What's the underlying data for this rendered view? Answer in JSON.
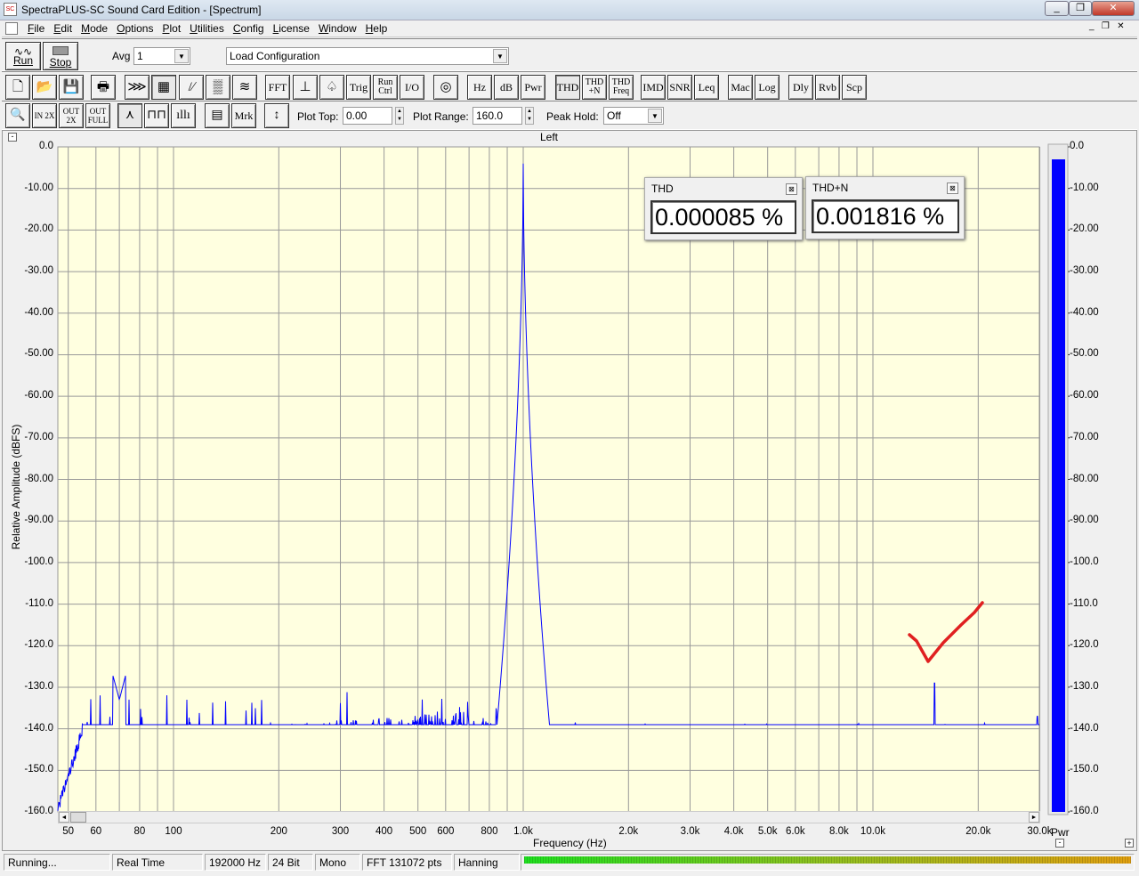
{
  "window": {
    "title": "SpectraPLUS-SC Sound Card Edition - [Spectrum]",
    "app_icon": "spectraplus-icon",
    "controls": [
      "minimize",
      "restore",
      "close"
    ]
  },
  "menu": [
    "File",
    "Edit",
    "Mode",
    "Options",
    "Plot",
    "Utilities",
    "Config",
    "License",
    "Window",
    "Help"
  ],
  "toolbar1": {
    "run": "Run",
    "stop": "Stop",
    "avg_label": "Avg",
    "avg_value": "1",
    "config_value": "Load Configuration"
  },
  "toolbar2": {
    "buttons": [
      "new",
      "open",
      "save",
      "print",
      "forward",
      "spectrum",
      "ramp",
      "spectrogram",
      "3d",
      "FFT",
      "scale",
      "tone",
      "Trig",
      "Run Ctrl",
      "I/O",
      "generator",
      "Hz",
      "dB",
      "Pwr",
      "THD",
      "THD +N",
      "THD Freq",
      "IMD",
      "SNR",
      "Leq",
      "Mac",
      "Log",
      "Dly",
      "Rvb",
      "Scp"
    ]
  },
  "toolbar3": {
    "buttons": [
      "zoom",
      "IN 2X",
      "OUT 2X",
      "OUT FULL",
      "line",
      "bar",
      "histogram",
      "table",
      "Mrk",
      "range"
    ],
    "plot_top_label": "Plot Top:",
    "plot_top_value": "0.00",
    "plot_range_label": "Plot Range:",
    "plot_range_value": "160.0",
    "peak_hold_label": "Peak Hold:",
    "peak_hold_value": "Off"
  },
  "measurements": [
    {
      "title": "THD",
      "value": "0.000085 %"
    },
    {
      "title": "THD+N",
      "value": "0.001816 %"
    }
  ],
  "chart_data": {
    "type": "line",
    "title": "Left",
    "xlabel": "Frequency (Hz)",
    "ylabel": "Relative Amplitude (dBFS)",
    "xscale": "log",
    "xlim": [
      46.6,
      30000
    ],
    "ylim": [
      -160,
      0
    ],
    "grid": true,
    "ytick_labels": [
      "0.0",
      "-10.00",
      "-20.00",
      "-30.00",
      "-40.00",
      "-50.00",
      "-60.00",
      "-70.00",
      "-80.00",
      "-90.00",
      "-100.0",
      "-110.0",
      "-120.0",
      "-130.0",
      "-140.0",
      "-150.0",
      "-160.0"
    ],
    "xticks": [
      {
        "v": 50,
        "l": "50"
      },
      {
        "v": 60,
        "l": "60"
      },
      {
        "v": 80,
        "l": "80"
      },
      {
        "v": 100,
        "l": "100"
      },
      {
        "v": 200,
        "l": "200"
      },
      {
        "v": 300,
        "l": "300"
      },
      {
        "v": 400,
        "l": "400"
      },
      {
        "v": 500,
        "l": "500"
      },
      {
        "v": 600,
        "l": "600"
      },
      {
        "v": 800,
        "l": "800"
      },
      {
        "v": 1000,
        "l": "1.0k"
      },
      {
        "v": 2000,
        "l": "2.0k"
      },
      {
        "v": 3000,
        "l": "3.0k"
      },
      {
        "v": 4000,
        "l": "4.0k"
      },
      {
        "v": 5000,
        "l": "5.0k"
      },
      {
        "v": 6000,
        "l": "6.0k"
      },
      {
        "v": 8000,
        "l": "8.0k"
      },
      {
        "v": 10000,
        "l": "10.0k"
      },
      {
        "v": 20000,
        "l": "20.0k"
      },
      {
        "v": 30000,
        "l": "30.0k"
      }
    ],
    "series": [
      {
        "name": "Left",
        "color": "#0000ff",
        "noise_floor_db": -145,
        "peaks": [
          {
            "freq": 1000,
            "db": -4
          },
          {
            "freq": 15000,
            "db": -129
          },
          {
            "freq": 70,
            "db": -133
          },
          {
            "freq": 29500,
            "db": -137
          }
        ]
      }
    ],
    "meter": {
      "label": "Pwr",
      "value_db": -3,
      "color": "#0000ff"
    },
    "plot_bg": "#ffffe0"
  },
  "status": [
    "Running...",
    "Real Time",
    "192000 Hz",
    "24 Bit",
    "Mono",
    "FFT 131072 pts",
    "Hanning"
  ]
}
